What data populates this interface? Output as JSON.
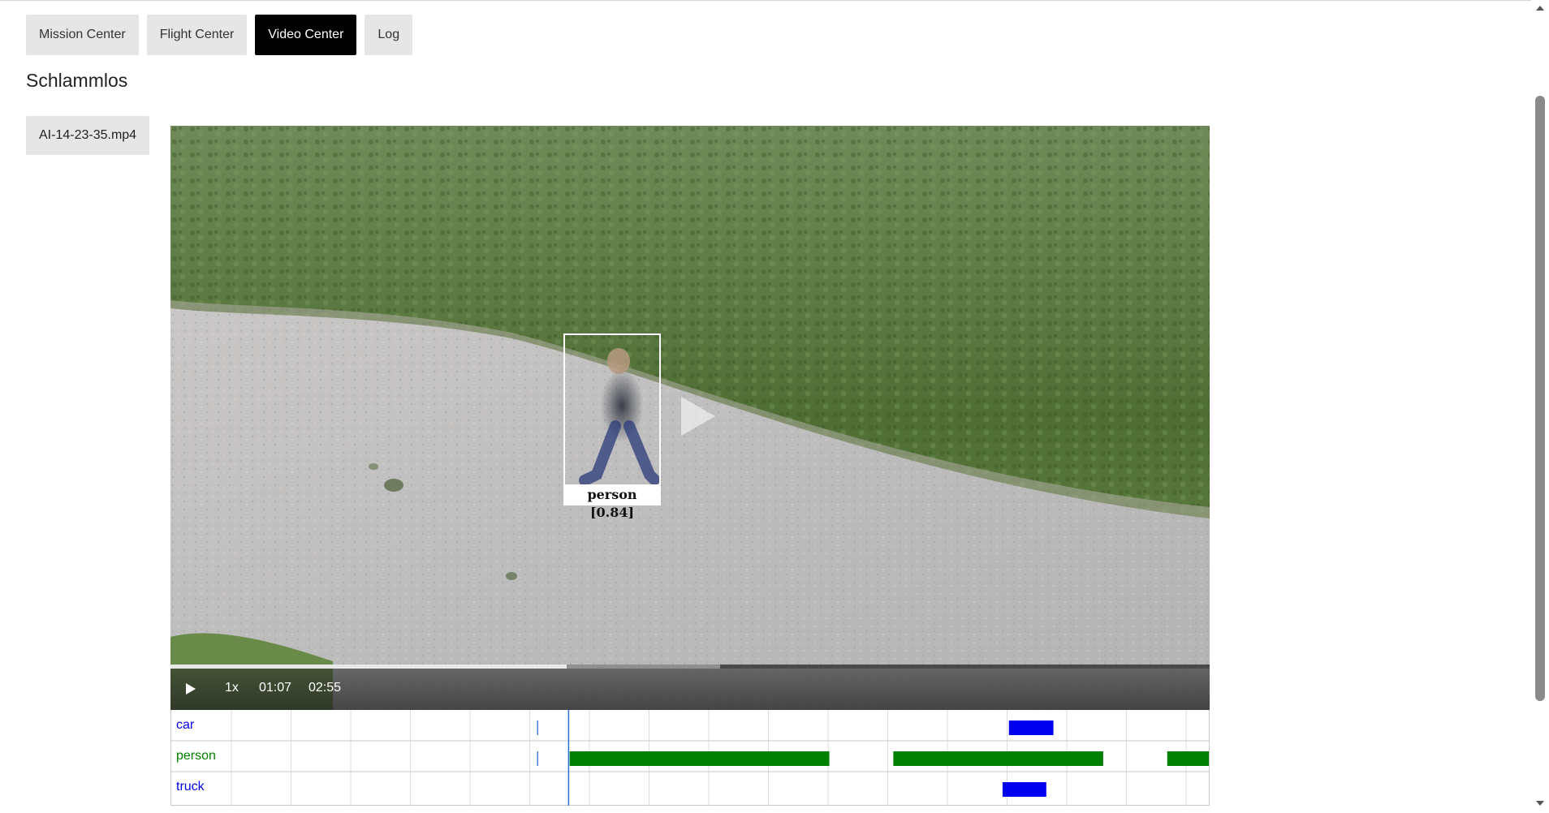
{
  "tabs": [
    {
      "label": "Mission Center",
      "active": false
    },
    {
      "label": "Flight Center",
      "active": false
    },
    {
      "label": "Video Center",
      "active": true
    },
    {
      "label": "Log",
      "active": false
    }
  ],
  "page_title": "Schlammlos",
  "file_button": "AI-14-23-35.mp4",
  "video": {
    "detection_label": "person [0.84]",
    "speed": "1x",
    "current_time": "01:07",
    "duration": "02:55",
    "progress_fraction": 0.381,
    "buffered_to_fraction": 0.529,
    "center_play_icon": "play-icon"
  },
  "timeline": {
    "tracks": [
      {
        "name": "car",
        "color": "#0000ee",
        "bar_color": "#0000ee",
        "segments": [
          [
            1.03,
            1.03
          ],
          [
            2.355,
            2.48
          ]
        ]
      },
      {
        "name": "person",
        "color": "#008000",
        "bar_color": "#008000",
        "segments": [
          [
            1.03,
            1.03
          ],
          [
            1.12,
            1.85
          ],
          [
            2.03,
            2.62
          ],
          [
            2.8,
            3.05
          ]
        ]
      },
      {
        "name": "truck",
        "color": "#0000ee",
        "bar_color": "#0000ee",
        "segments": [
          [
            2.337,
            2.46
          ]
        ]
      }
    ],
    "playhead_minutes": 1.117,
    "duration_minutes": 2.917
  }
}
